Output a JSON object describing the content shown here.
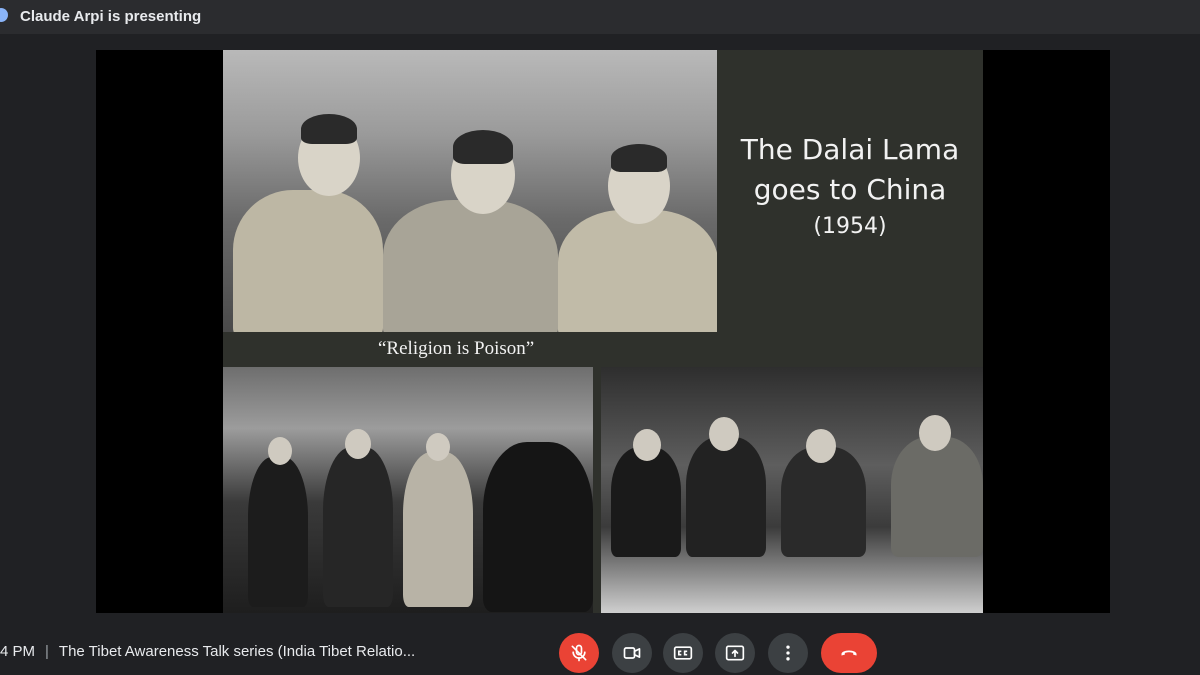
{
  "topbar": {
    "presenting_text": "Claude Arpi is presenting"
  },
  "slide": {
    "title_line1": "The Dalai Lama",
    "title_line2": "goes to China",
    "title_year": "(1954)",
    "caption": "“Religion is Poison”"
  },
  "bottombar": {
    "time": "4 PM",
    "meeting_title": "The Tibet Awareness Talk series (India Tibet Relatio..."
  },
  "controls": {
    "mic_icon": "mic-off-icon",
    "camera_icon": "videocam-icon",
    "captions_icon": "closed-captions-icon",
    "present_icon": "present-screen-icon",
    "more_icon": "more-vertical-icon",
    "end_call_icon": "call-end-icon"
  },
  "colors": {
    "background": "#202124",
    "slide_background": "#2f312c",
    "danger": "#ea4335",
    "control_gray": "#3c4043"
  }
}
